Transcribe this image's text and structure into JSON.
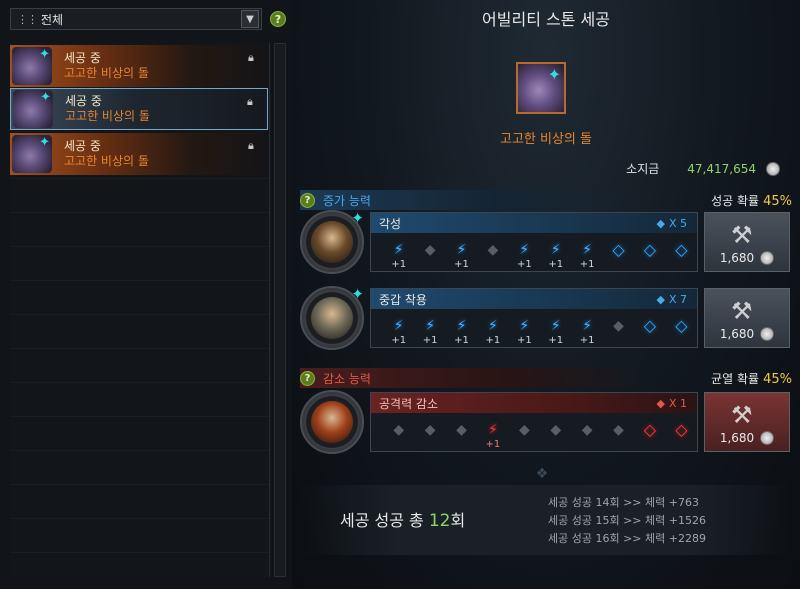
{
  "left": {
    "filter": {
      "grid_icon": "grid-icon",
      "label": "전체",
      "dropdown_glyph": "▼"
    },
    "help": "?",
    "items": [
      {
        "status": "세공 중",
        "name": "고고한 비상의 돌",
        "style": "orange"
      },
      {
        "status": "세공 중",
        "name": "고고한 비상의 돌",
        "style": "selected"
      },
      {
        "status": "세공 중",
        "name": "고고한 비상의 돌",
        "style": "orange"
      }
    ]
  },
  "right": {
    "title": "어빌리티 스톤 세공",
    "stone_name": "고고한 비상의 돌",
    "gold_label": "소지금",
    "gold_value": "47,417,654",
    "increase_section": {
      "label": "증가 능력",
      "rate_label": "성공 확률",
      "rate_value": "45%",
      "help": "?"
    },
    "decrease_section": {
      "label": "감소 능력",
      "rate_label": "균열 확률",
      "rate_value": "45%",
      "help": "?"
    },
    "abilities": [
      {
        "name": "각성",
        "multiplier": "X 5",
        "type": "inc",
        "portrait_color": "#6a4a2a",
        "nodes": [
          "success",
          "fail",
          "success",
          "fail",
          "success",
          "success",
          "success",
          "empty",
          "empty",
          "empty"
        ],
        "cost": "1,680"
      },
      {
        "name": "중갑 착용",
        "multiplier": "X 7",
        "type": "inc",
        "portrait_color": "#6e6a58",
        "nodes": [
          "success",
          "success",
          "success",
          "success",
          "success",
          "success",
          "success",
          "fail",
          "empty",
          "empty"
        ],
        "cost": "1,680"
      },
      {
        "name": "공격력 감소",
        "multiplier": "X 1",
        "type": "dec",
        "portrait_color": "#a0401a",
        "nodes": [
          "fail",
          "fail",
          "fail",
          "success",
          "fail",
          "fail",
          "fail",
          "fail",
          "empty",
          "empty"
        ],
        "cost": "1,680"
      }
    ],
    "plus_label": "+1",
    "summary": {
      "prefix": "세공 성공 총 ",
      "count": "12",
      "suffix": "회",
      "list": [
        "세공 성공 14회 >> 체력 +763",
        "세공 성공 15회 >> 체력 +1526",
        "세공 성공 16회 >> 체력 +2289"
      ]
    },
    "colors": {
      "accent_blue": "#3cb4ff",
      "accent_red": "#e03a3a",
      "gold_green": "#8fd468",
      "rate_yellow": "#f2c94c",
      "stone_orange": "#e8862e"
    }
  }
}
